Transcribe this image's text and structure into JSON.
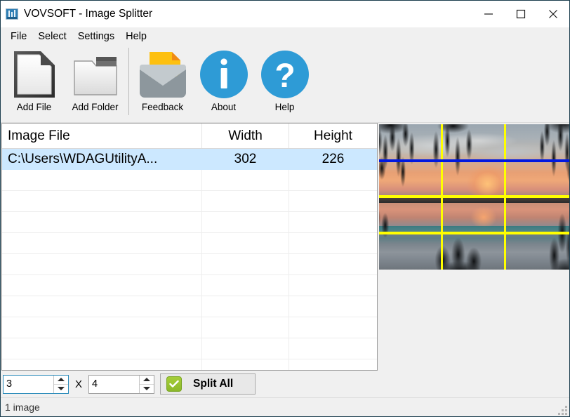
{
  "window": {
    "title": "VOVSOFT - Image Splitter",
    "app_icon": "image-splitter-icon",
    "minimize_label": "Minimize",
    "maximize_label": "Maximize",
    "close_label": "Close"
  },
  "menubar": {
    "items": [
      {
        "label": "File",
        "name": "menu-file"
      },
      {
        "label": "Select",
        "name": "menu-select"
      },
      {
        "label": "Settings",
        "name": "menu-settings"
      },
      {
        "label": "Help",
        "name": "menu-help"
      }
    ]
  },
  "toolbar": {
    "buttons": [
      {
        "label": "Add File",
        "icon": "document-page-icon"
      },
      {
        "label": "Add Folder",
        "icon": "folder-icon"
      },
      {
        "label": "Feedback",
        "icon": "envelope-mail-icon"
      },
      {
        "label": "About",
        "icon": "info-circle-icon"
      },
      {
        "label": "Help",
        "icon": "question-mark-circle-icon"
      }
    ]
  },
  "file_list": {
    "columns": [
      "Image File",
      "Width",
      "Height"
    ],
    "rows": [
      {
        "file": "C:\\Users\\WDAGUtilityA...",
        "width": "302",
        "height": "226",
        "selected": true
      }
    ],
    "empty_row_count": 10,
    "selection_color": "#cce8ff"
  },
  "preview": {
    "name": "image-preview",
    "grid_columns": 3,
    "grid_rows": 4,
    "grid_line_color": "#ffff00",
    "accent_line_color": "#0018e0",
    "description": "Sunset over a lake framed by willow branches, with yellow split guide lines"
  },
  "bottom_bar": {
    "columns_value": "3",
    "columns_placeholder": "3",
    "separator": "X",
    "rows_value": "4",
    "rows_placeholder": "4",
    "split_label": "Split All",
    "split_icon": "green-check-icon",
    "spin_up": "increment",
    "spin_down": "decrement"
  },
  "status_bar": {
    "text": "1 image",
    "grip": "resize-grip"
  }
}
